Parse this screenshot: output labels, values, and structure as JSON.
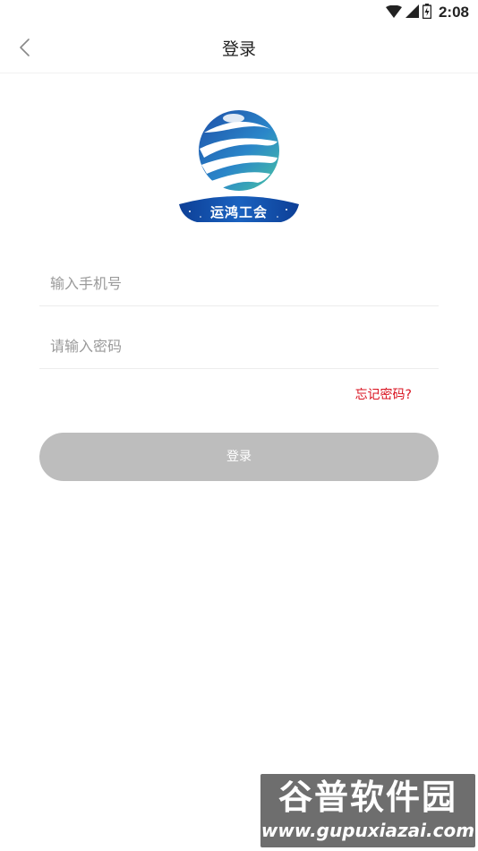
{
  "status_bar": {
    "time": "2:08",
    "icons": [
      "wifi-icon",
      "cellular-signal-icon",
      "battery-icon"
    ]
  },
  "nav": {
    "title": "登录",
    "back_icon": "chevron-left-icon"
  },
  "logo": {
    "text": "运鸿工会"
  },
  "form": {
    "phone_placeholder": "输入手机号",
    "phone_value": "",
    "password_placeholder": "请输入密码",
    "password_value": "",
    "forgot_label": "忘记密码?",
    "login_label": "登录"
  },
  "watermark": {
    "brand": "谷普软件园",
    "url": "www.gupuxiazai.com"
  },
  "colors": {
    "link": "#d9121f",
    "button_disabled": "#bdbdbd",
    "globe_blue": "#1a5fb4",
    "globe_teal": "#3fb8a5"
  }
}
